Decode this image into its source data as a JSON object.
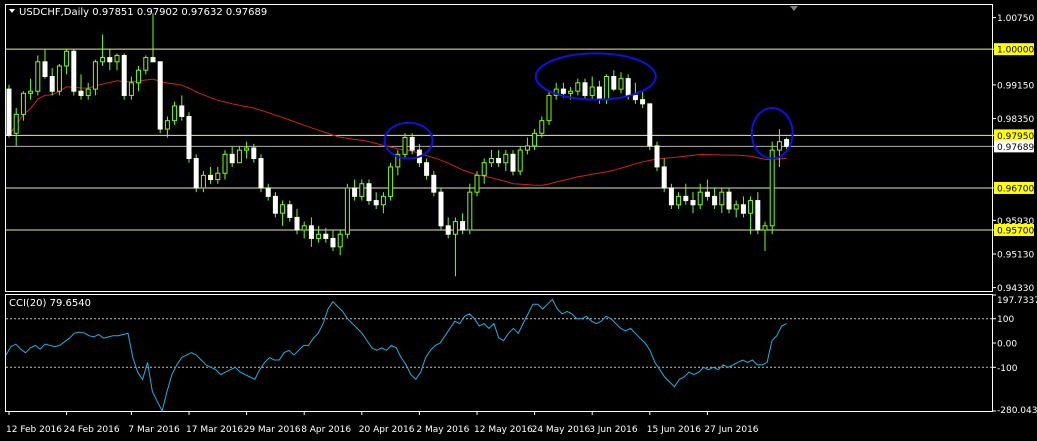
{
  "chart_data": [
    {
      "type": "candlestick",
      "title": "USDCHF,Daily",
      "ohlc_header": "0.97851 0.97902 0.97632 0.97689",
      "y_ticks": [
        "1.00750",
        "1.00000",
        "0.99150",
        "0.98350",
        "0.97950",
        "0.97689",
        "0.96700",
        "0.95930",
        "0.95700",
        "0.95130",
        "0.94330"
      ],
      "x_ticks": [
        "12 Feb 2016",
        "24 Feb 2016",
        "7 Mar 2016",
        "17 Mar 2016",
        "29 Mar 2016",
        "8 Apr 2016",
        "20 Apr 2016",
        "2 May 2016",
        "12 May 2016",
        "24 May 2016",
        "3 Jun 2016",
        "15 Jun 2016",
        "27 Jun 2016"
      ],
      "ylim": [
        0.9425,
        1.0105
      ],
      "horizontal_levels": [
        1.0,
        0.9795,
        0.967,
        0.957
      ],
      "highlighted_levels": [
        "1.00000",
        "0.97950",
        "0.96700",
        "0.95700"
      ],
      "current_price": "0.97689",
      "moving_average": "red line",
      "annotations": [
        "blue ellipse around 20 Apr 2016 top",
        "blue ellipse around 12–31 May 2016 plateau",
        "blue ellipse around 27–28 Jun 2016"
      ],
      "candles": [
        [
          0.9905,
          0.9915,
          0.979,
          0.9795
        ],
        [
          0.98,
          0.986,
          0.977,
          0.9845
        ],
        [
          0.9845,
          0.99,
          0.983,
          0.9895
        ],
        [
          0.9895,
          0.993,
          0.988,
          0.99
        ],
        [
          0.99,
          0.9985,
          0.989,
          0.997
        ],
        [
          0.997,
          1.0,
          0.993,
          0.9935
        ],
        [
          0.9935,
          0.9955,
          0.989,
          0.99
        ],
        [
          0.99,
          0.9965,
          0.989,
          0.996
        ],
        [
          0.996,
          1.0,
          0.994,
          0.9995
        ],
        [
          0.9995,
          1.0,
          0.989,
          0.99
        ],
        [
          0.99,
          0.994,
          0.988,
          0.989
        ],
        [
          0.989,
          0.992,
          0.988,
          0.9905
        ],
        [
          0.9905,
          0.9975,
          0.989,
          0.997
        ],
        [
          0.997,
          1.0035,
          0.996,
          0.998
        ],
        [
          0.998,
          1.0,
          0.995,
          0.997
        ],
        [
          0.997,
          0.999,
          0.995,
          0.9985
        ],
        [
          0.9985,
          0.999,
          0.988,
          0.989
        ],
        [
          0.989,
          0.9935,
          0.988,
          0.992
        ],
        [
          0.992,
          0.996,
          0.99,
          0.995
        ],
        [
          0.995,
          0.9985,
          0.994,
          0.998
        ],
        [
          0.998,
          1.0085,
          0.997,
          0.997
        ],
        [
          0.997,
          0.997,
          0.98,
          0.981
        ],
        [
          0.981,
          0.984,
          0.979,
          0.983
        ],
        [
          0.983,
          0.9875,
          0.982,
          0.9865
        ],
        [
          0.9865,
          0.989,
          0.983,
          0.984
        ],
        [
          0.984,
          0.985,
          0.973,
          0.974
        ],
        [
          0.974,
          0.975,
          0.966,
          0.967
        ],
        [
          0.967,
          0.971,
          0.966,
          0.97
        ],
        [
          0.97,
          0.972,
          0.968,
          0.969
        ],
        [
          0.969,
          0.972,
          0.968,
          0.9705
        ],
        [
          0.9705,
          0.976,
          0.969,
          0.975
        ],
        [
          0.975,
          0.977,
          0.972,
          0.973
        ],
        [
          0.973,
          0.977,
          0.973,
          0.976
        ],
        [
          0.976,
          0.978,
          0.974,
          0.9765
        ],
        [
          0.9765,
          0.9775,
          0.973,
          0.974
        ],
        [
          0.974,
          0.975,
          0.966,
          0.967
        ],
        [
          0.967,
          0.968,
          0.964,
          0.965
        ],
        [
          0.965,
          0.966,
          0.96,
          0.961
        ],
        [
          0.961,
          0.964,
          0.958,
          0.963
        ],
        [
          0.963,
          0.964,
          0.959,
          0.96
        ],
        [
          0.96,
          0.962,
          0.956,
          0.957
        ],
        [
          0.957,
          0.959,
          0.955,
          0.958
        ],
        [
          0.958,
          0.96,
          0.953,
          0.955
        ],
        [
          0.955,
          0.958,
          0.954,
          0.956
        ],
        [
          0.956,
          0.9575,
          0.954,
          0.955
        ],
        [
          0.955,
          0.957,
          0.952,
          0.953
        ],
        [
          0.953,
          0.957,
          0.951,
          0.956
        ],
        [
          0.956,
          0.968,
          0.955,
          0.967
        ],
        [
          0.967,
          0.969,
          0.964,
          0.965
        ],
        [
          0.965,
          0.969,
          0.964,
          0.968
        ],
        [
          0.968,
          0.969,
          0.963,
          0.964
        ],
        [
          0.964,
          0.966,
          0.962,
          0.963
        ],
        [
          0.963,
          0.966,
          0.961,
          0.965
        ],
        [
          0.965,
          0.973,
          0.964,
          0.972
        ],
        [
          0.972,
          0.976,
          0.97,
          0.975
        ],
        [
          0.975,
          0.98,
          0.974,
          0.979
        ],
        [
          0.979,
          0.98,
          0.975,
          0.976
        ],
        [
          0.976,
          0.9775,
          0.972,
          0.973
        ],
        [
          0.973,
          0.974,
          0.969,
          0.97
        ],
        [
          0.97,
          0.971,
          0.965,
          0.966
        ],
        [
          0.966,
          0.967,
          0.957,
          0.958
        ],
        [
          0.958,
          0.96,
          0.955,
          0.956
        ],
        [
          0.956,
          0.96,
          0.946,
          0.959
        ],
        [
          0.959,
          0.961,
          0.956,
          0.957
        ],
        [
          0.957,
          0.968,
          0.956,
          0.966
        ],
        [
          0.966,
          0.971,
          0.965,
          0.97
        ],
        [
          0.97,
          0.974,
          0.968,
          0.973
        ],
        [
          0.973,
          0.976,
          0.972,
          0.974
        ],
        [
          0.974,
          0.976,
          0.972,
          0.973
        ],
        [
          0.973,
          0.976,
          0.971,
          0.975
        ],
        [
          0.975,
          0.976,
          0.97,
          0.971
        ],
        [
          0.971,
          0.977,
          0.97,
          0.976
        ],
        [
          0.976,
          0.979,
          0.975,
          0.977
        ],
        [
          0.977,
          0.981,
          0.976,
          0.98
        ],
        [
          0.98,
          0.984,
          0.979,
          0.983
        ],
        [
          0.983,
          0.99,
          0.982,
          0.989
        ],
        [
          0.989,
          0.992,
          0.988,
          0.9905
        ],
        [
          0.9905,
          0.992,
          0.9885,
          0.9895
        ],
        [
          0.9895,
          0.991,
          0.988,
          0.99
        ],
        [
          0.99,
          0.993,
          0.989,
          0.992
        ],
        [
          0.992,
          0.993,
          0.988,
          0.989
        ],
        [
          0.989,
          0.9935,
          0.988,
          0.991
        ],
        [
          0.991,
          0.9925,
          0.987,
          0.988
        ],
        [
          0.988,
          0.994,
          0.987,
          0.9935
        ],
        [
          0.9935,
          0.995,
          0.99,
          0.9905
        ],
        [
          0.9905,
          0.9945,
          0.9895,
          0.993
        ],
        [
          0.993,
          0.994,
          0.988,
          0.989
        ],
        [
          0.989,
          0.992,
          0.987,
          0.988
        ],
        [
          0.988,
          0.99,
          0.986,
          0.987
        ],
        [
          0.987,
          0.987,
          0.976,
          0.977
        ],
        [
          0.977,
          0.978,
          0.971,
          0.972
        ],
        [
          0.972,
          0.974,
          0.966,
          0.967
        ],
        [
          0.967,
          0.968,
          0.962,
          0.963
        ],
        [
          0.963,
          0.966,
          0.962,
          0.965
        ],
        [
          0.965,
          0.968,
          0.963,
          0.964
        ],
        [
          0.964,
          0.966,
          0.961,
          0.963
        ],
        [
          0.963,
          0.968,
          0.962,
          0.966
        ],
        [
          0.966,
          0.969,
          0.964,
          0.965
        ],
        [
          0.965,
          0.967,
          0.962,
          0.963
        ],
        [
          0.963,
          0.967,
          0.961,
          0.966
        ],
        [
          0.966,
          0.967,
          0.961,
          0.962
        ],
        [
          0.962,
          0.964,
          0.96,
          0.963
        ],
        [
          0.963,
          0.965,
          0.96,
          0.961
        ],
        [
          0.961,
          0.965,
          0.956,
          0.964
        ],
        [
          0.964,
          0.966,
          0.956,
          0.957
        ],
        [
          0.957,
          0.959,
          0.952,
          0.958
        ],
        [
          0.958,
          0.978,
          0.956,
          0.976
        ],
        [
          0.976,
          0.981,
          0.972,
          0.978
        ],
        [
          0.9785,
          0.979,
          0.9763,
          0.9769
        ]
      ]
    },
    {
      "type": "line",
      "title": "CCI(20) 79.6540",
      "y_ticks": [
        "197.7337",
        "100",
        "0.00",
        "-100",
        "-280.0437"
      ],
      "ylim": [
        -280.0437,
        197.7337
      ],
      "levels": [
        100,
        -100
      ],
      "values": [
        -50,
        -15,
        -5,
        -25,
        -40,
        -20,
        -10,
        -25,
        -5,
        -10,
        -15,
        -10,
        5,
        20,
        40,
        45,
        42,
        30,
        25,
        35,
        20,
        25,
        30,
        30,
        35,
        40,
        -60,
        -120,
        -150,
        -80,
        -200,
        -240,
        -280,
        -200,
        -130,
        -90,
        -60,
        -50,
        -40,
        -50,
        -70,
        -90,
        -100,
        -110,
        -130,
        -120,
        -110,
        -100,
        -120,
        -130,
        -140,
        -150,
        -110,
        -80,
        -60,
        -70,
        -70,
        -40,
        -30,
        -50,
        -30,
        -10,
        -10,
        20,
        40,
        80,
        140,
        170,
        150,
        130,
        100,
        80,
        60,
        40,
        10,
        -20,
        -30,
        -20,
        -30,
        -10,
        -20,
        -60,
        -90,
        -130,
        -150,
        -120,
        -60,
        -30,
        -10,
        0,
        30,
        60,
        90,
        80,
        110,
        120,
        100,
        70,
        80,
        60,
        80,
        20,
        10,
        40,
        60,
        40,
        80,
        120,
        160,
        160,
        140,
        160,
        180,
        140,
        120,
        130,
        120,
        100,
        100,
        110,
        90,
        80,
        90,
        110,
        100,
        80,
        60,
        50,
        60,
        40,
        20,
        0,
        -30,
        -80,
        -110,
        -140,
        -160,
        -180,
        -150,
        -140,
        -120,
        -130,
        -120,
        -100,
        -110,
        -100,
        -110,
        -90,
        -100,
        -90,
        -80,
        -70,
        -80,
        -70,
        -90,
        -90,
        -80,
        10,
        30,
        70,
        80
      ]
    }
  ]
}
